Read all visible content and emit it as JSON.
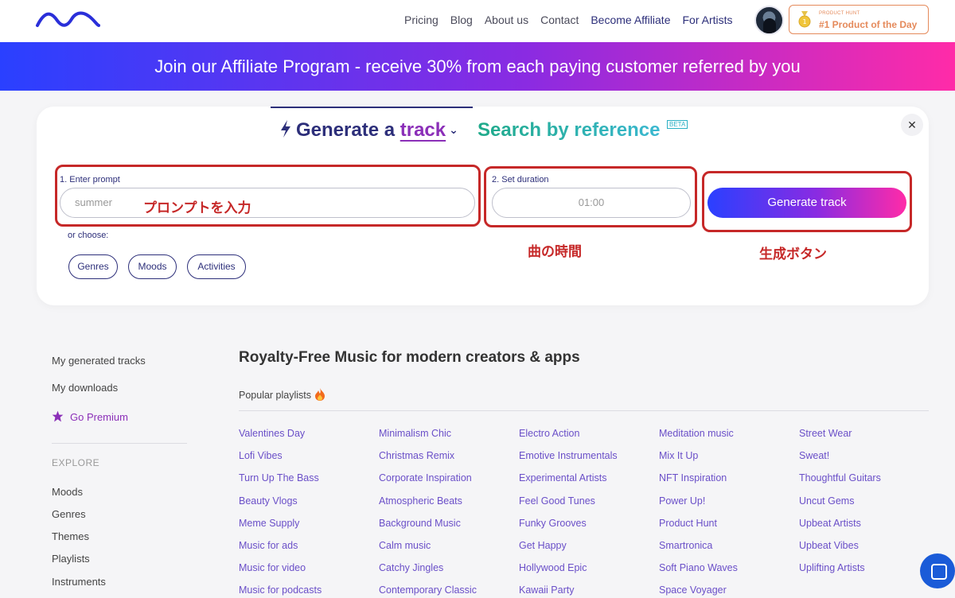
{
  "nav": {
    "items": [
      "Pricing",
      "Blog",
      "About us",
      "Contact",
      "Become Affiliate",
      "For Artists"
    ]
  },
  "product_hunt": {
    "small": "PRODUCT HUNT",
    "big": "#1 Product of the Day"
  },
  "banner": {
    "text": "Join our Affiliate Program - receive 30% from each paying customer referred by you"
  },
  "tabs": {
    "generate_prefix": "Generate a",
    "generate_word": "track",
    "search_label": "Search by reference",
    "beta": "BETA"
  },
  "form": {
    "prompt_label": "1. Enter prompt",
    "prompt_value": "summer",
    "duration_label": "2. Set duration",
    "duration_value": "01:00",
    "generate_button": "Generate track",
    "or_choose": "or choose:",
    "chips": [
      "Genres",
      "Moods",
      "Activities"
    ]
  },
  "annotations": {
    "prompt": "プロンプトを入力",
    "duration": "曲の時間",
    "generate": "生成ボタン"
  },
  "sidebar": {
    "my_generated": "My generated tracks",
    "my_downloads": "My downloads",
    "premium": "Go Premium",
    "explore": "EXPLORE",
    "explore_items": [
      "Moods",
      "Genres",
      "Themes",
      "Playlists",
      "Instruments"
    ]
  },
  "content": {
    "title": "Royalty-Free Music for modern creators & apps",
    "popular": "Popular playlists",
    "columns": [
      [
        "Valentines Day",
        "Lofi Vibes",
        "Turn Up The Bass",
        "Beauty Vlogs",
        "Meme Supply",
        "Music for ads",
        "Music for video",
        "Music for podcasts"
      ],
      [
        "Minimalism Chic",
        "Christmas Remix",
        "Corporate Inspiration",
        "Atmospheric Beats",
        "Background Music",
        "Calm music",
        "Catchy Jingles",
        "Contemporary Classic"
      ],
      [
        "Electro Action",
        "Emotive Instrumentals",
        "Experimental Artists",
        "Feel Good Tunes",
        "Funky Grooves",
        "Get Happy",
        "Hollywood Epic",
        "Kawaii Party"
      ],
      [
        "Meditation music",
        "Mix It Up",
        "NFT Inspiration",
        "Power Up!",
        "Product Hunt",
        "Smartronica",
        "Soft Piano Waves",
        "Space Voyager"
      ],
      [
        "Street Wear",
        "Sweat!",
        "Thoughtful Guitars",
        "Uncut Gems",
        "Upbeat Artists",
        "Upbeat Vibes",
        "Uplifting Artists"
      ]
    ]
  },
  "colors": {
    "brand_navy": "#2d2f7a",
    "gradient_start": "#2a40ff",
    "gradient_end": "#ff2ba8",
    "annotation_red": "#c62828",
    "link_purple": "#6a4fc8"
  },
  "icons": {
    "logo": "wave-logo-icon",
    "medal": "medal-icon",
    "bolt": "lightning-bolt-icon",
    "chevron": "chevron-down-icon",
    "close": "close-icon",
    "star": "star-icon",
    "fire": "fire-icon",
    "chat": "chat-icon"
  }
}
